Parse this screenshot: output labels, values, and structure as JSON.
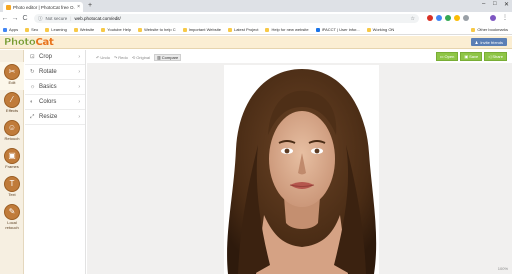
{
  "browser": {
    "tab_title": "Photo editor | PhotoCat free O...",
    "tab_close": "×",
    "new_tab": "+",
    "window_controls": [
      "–",
      "□",
      "✕"
    ],
    "nav": {
      "back": "←",
      "forward": "→",
      "reload": "C"
    },
    "address": {
      "security_label": "Not secure",
      "url": "web.photocat.com/edit/"
    },
    "star": "☆"
  },
  "bookmarks": {
    "items": [
      "Apps",
      "Seo",
      "Learning",
      "Website",
      "Youtube Help",
      "Website to help C",
      "Important Website",
      "Latest Project",
      "Help for new website",
      "IPACCT | User infor...",
      "Working ON"
    ],
    "other": "Other bookmarks"
  },
  "app": {
    "logo_part1": "Photo",
    "logo_part2": "Cat",
    "invite_label": "Invite friends"
  },
  "left_tools": [
    {
      "label": "Edit",
      "icon": "scissors-icon",
      "glyph": "✂"
    },
    {
      "label": "Effects",
      "icon": "wand-icon",
      "glyph": "⁄"
    },
    {
      "label": "Retouch",
      "icon": "face-icon",
      "glyph": "☺"
    },
    {
      "label": "Frames",
      "icon": "frame-icon",
      "glyph": "▣"
    },
    {
      "label": "Text",
      "icon": "text-icon",
      "glyph": "T"
    },
    {
      "label": "Local retouch",
      "icon": "brush-icon",
      "glyph": "✎"
    }
  ],
  "edit_panel": {
    "items": [
      {
        "label": "Crop",
        "icon": "crop-icon",
        "glyph": "⊡"
      },
      {
        "label": "Rotate",
        "icon": "rotate-icon",
        "glyph": "↻"
      },
      {
        "label": "Basics",
        "icon": "sun-icon",
        "glyph": "☼"
      },
      {
        "label": "Colors",
        "icon": "palette-icon",
        "glyph": "◐"
      },
      {
        "label": "Resize",
        "icon": "resize-icon",
        "glyph": "⤢"
      }
    ],
    "chevron": "›"
  },
  "toolbar": {
    "undo": "Undo",
    "redo": "Redo",
    "original": "Original",
    "compare": "Compare"
  },
  "actions": {
    "open": "Open",
    "save": "Save",
    "share": "Share"
  },
  "canvas": {
    "zoom": "100%"
  }
}
